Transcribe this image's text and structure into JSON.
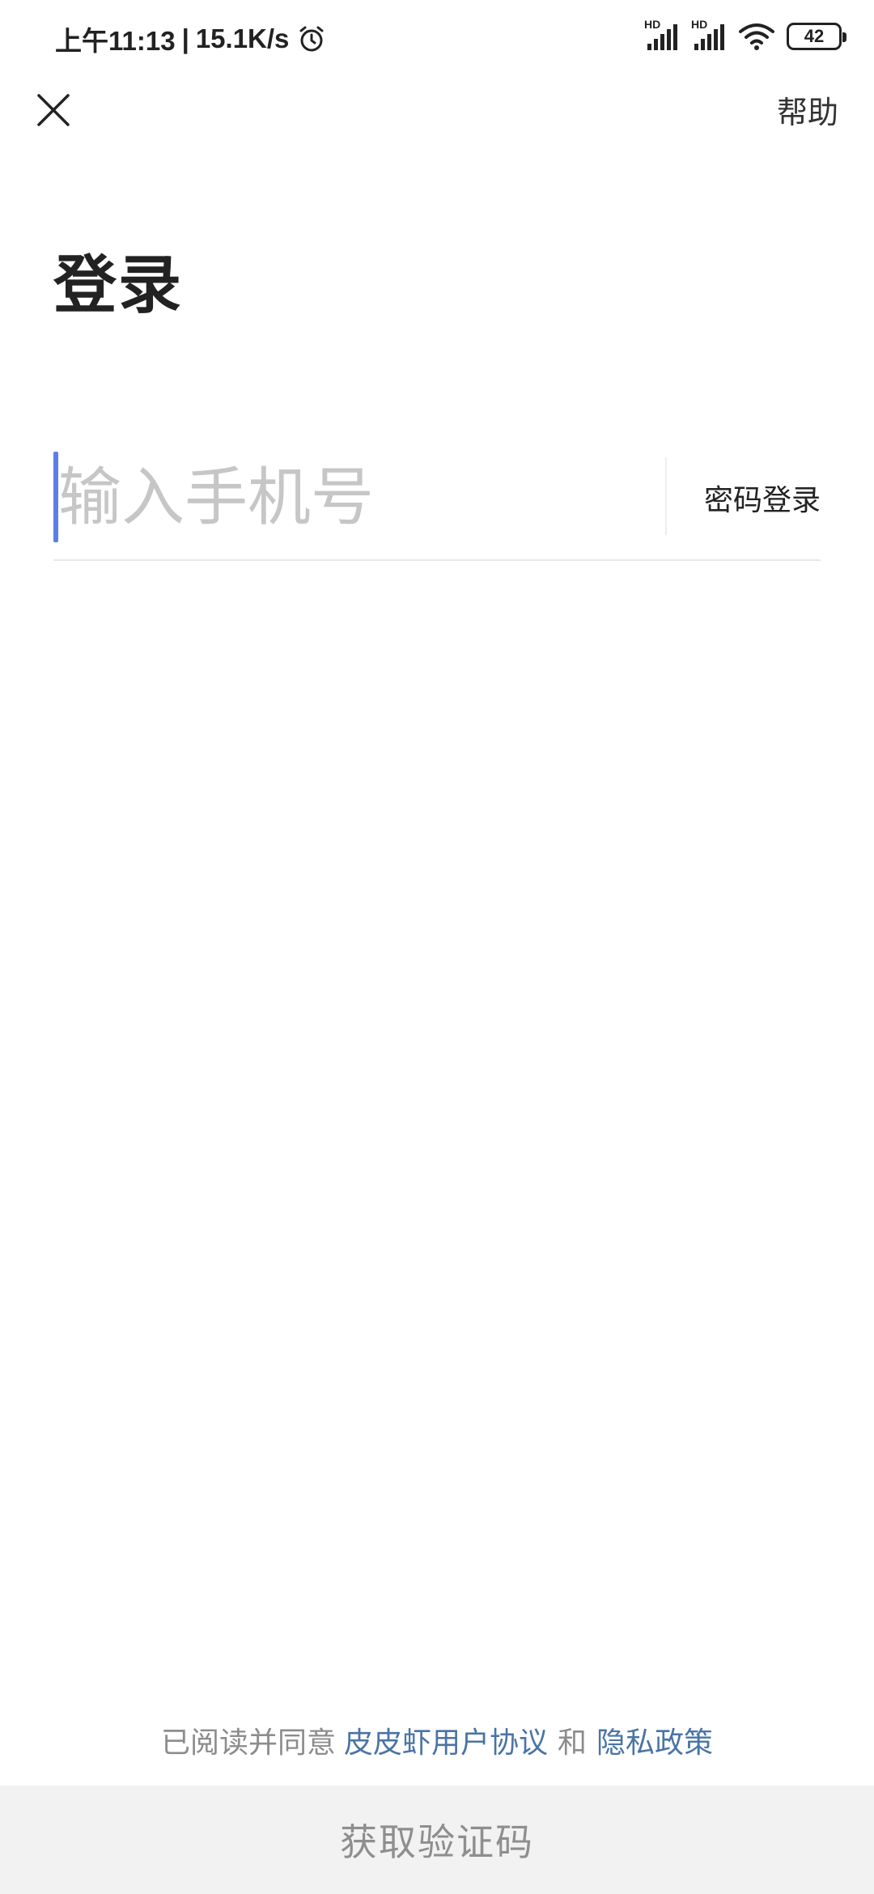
{
  "status_bar": {
    "time": "上午11:13",
    "separator": "|",
    "speed": "15.1K/s",
    "sim1_label": "HD",
    "sim2_label": "HD",
    "battery": "42",
    "icons": [
      "alarm-icon",
      "signal-icon",
      "signal-icon",
      "wifi-icon",
      "battery-icon"
    ]
  },
  "header": {
    "close_icon": "close-icon",
    "help_label": "帮助"
  },
  "main": {
    "title": "登录",
    "phone_placeholder": "输入手机号",
    "phone_value": "",
    "password_login_label": "密码登录"
  },
  "agreement": {
    "lead": "已阅读并同意",
    "user_agreement": "皮皮虾用户协议",
    "and": "和",
    "privacy_policy": "隐私政策",
    "link_color": "#4a74a5"
  },
  "footer": {
    "get_code_label": "获取验证码"
  },
  "colors": {
    "caret": "#5b7fe6",
    "button_bg": "#f2f2f2",
    "button_text": "#8e8e8e"
  }
}
